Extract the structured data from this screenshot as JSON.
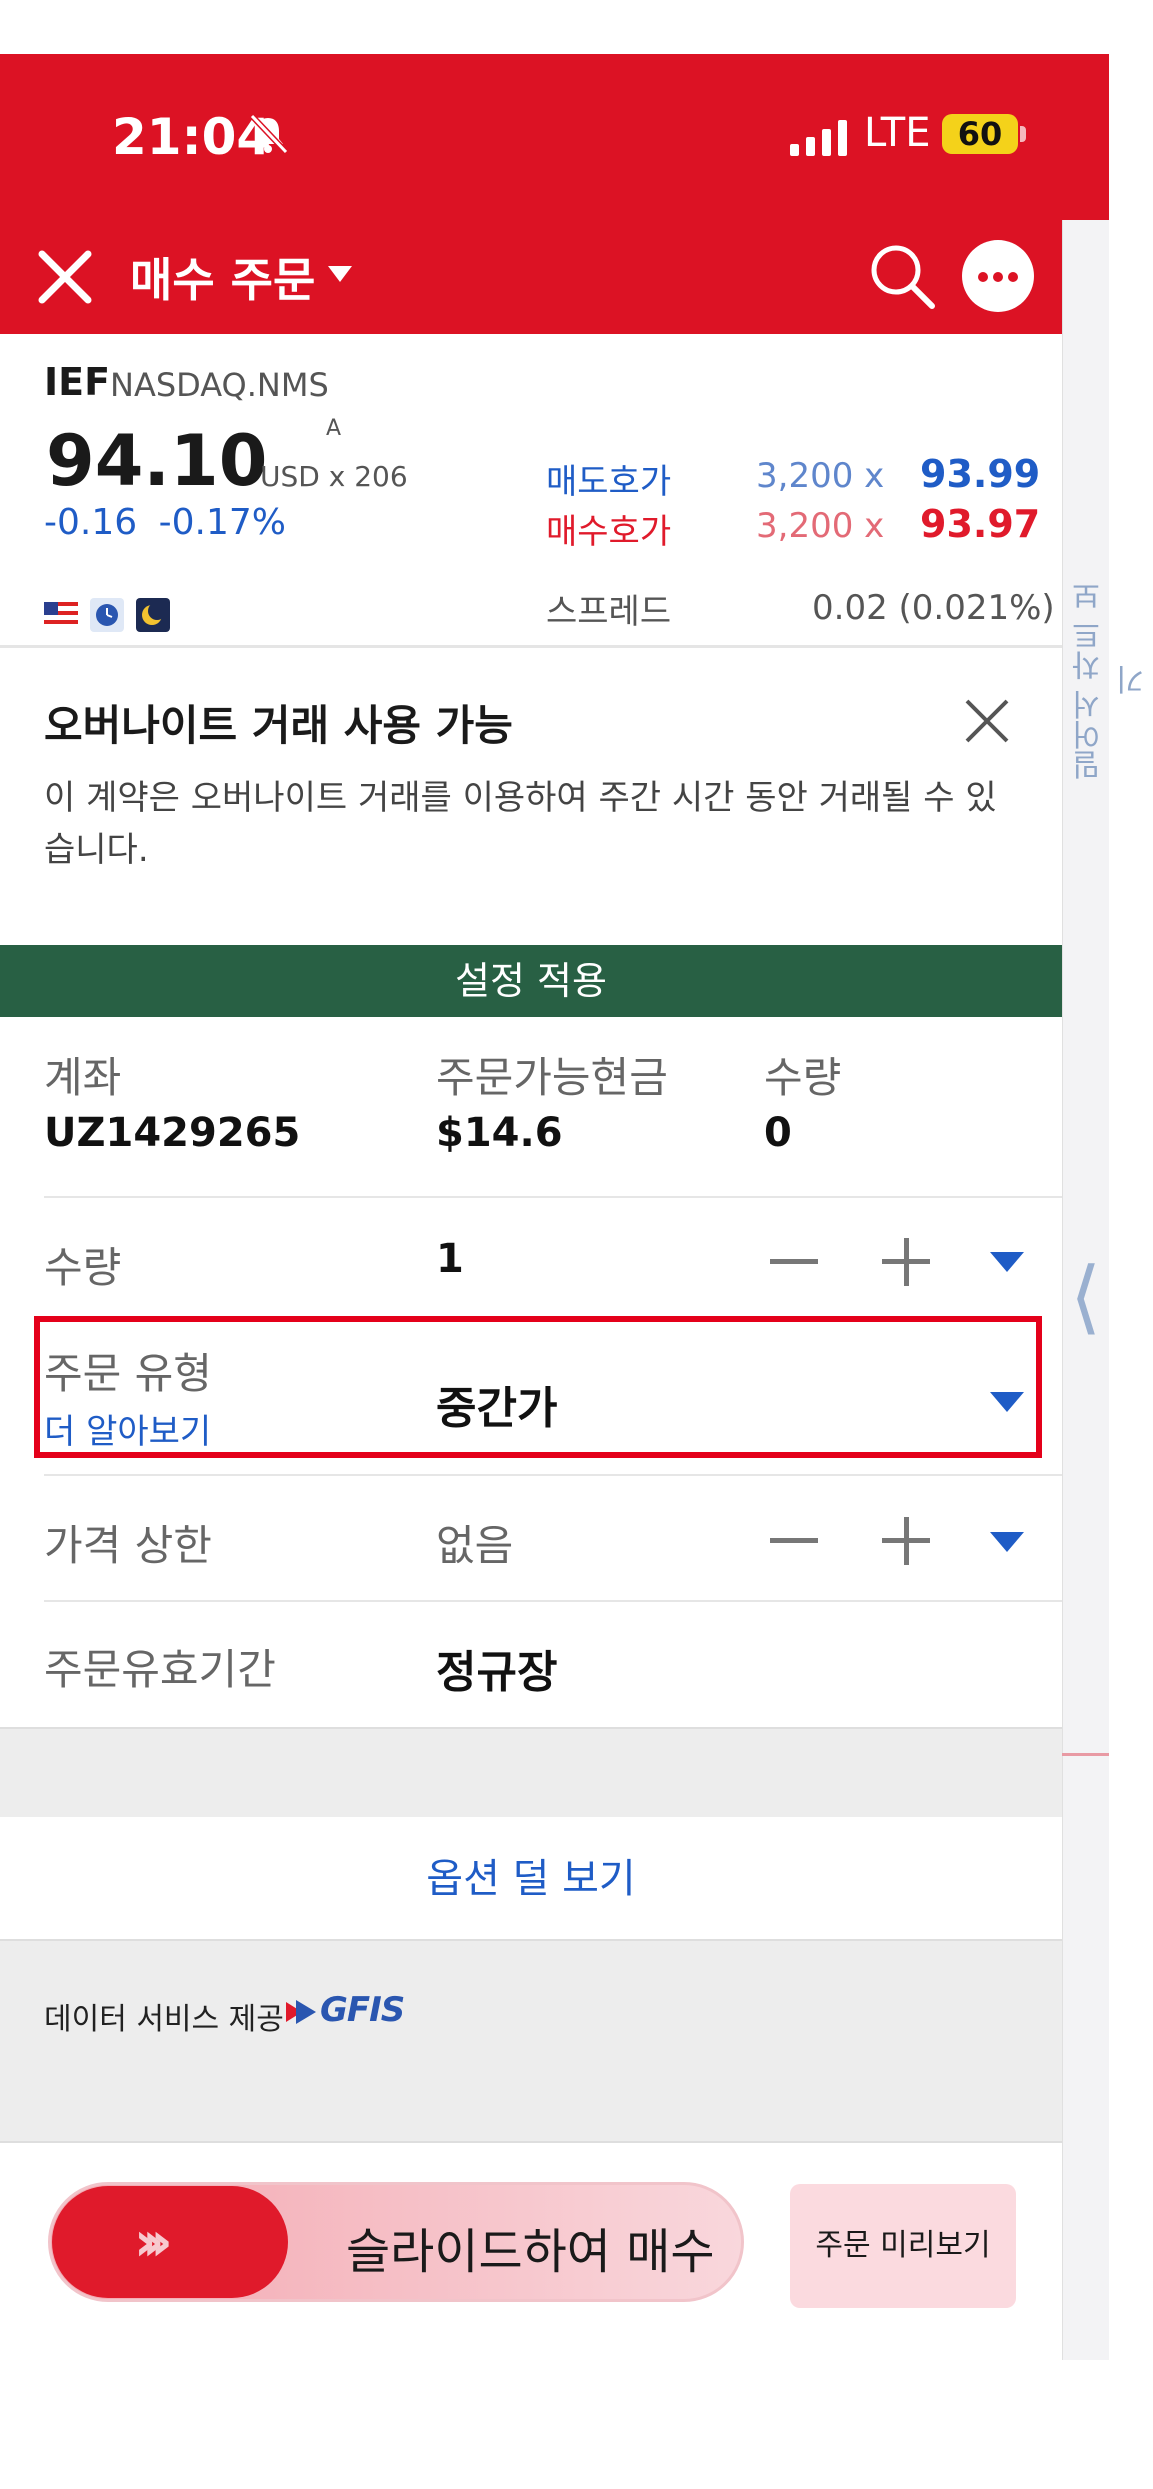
{
  "status_bar": {
    "time": "21:04",
    "network": "LTE",
    "battery": "60"
  },
  "nav": {
    "title": "매수 주문"
  },
  "quote": {
    "symbol": "IEF",
    "exchange": "NASDAQ.NMS",
    "last_price": "94.10",
    "currency": "USD",
    "size_prefix": "x",
    "size": "206",
    "size_marker": "A",
    "change": "-0.16",
    "change_pct": "-0.17%",
    "ask_label": "매도호가",
    "ask_size": "3,200",
    "ask_x": "x",
    "ask_price": "93.99",
    "bid_label": "매수호가",
    "bid_size": "3,200",
    "bid_x": "x",
    "bid_price": "93.97",
    "spread_label": "스프레드",
    "spread_value": "0.02 (0.021%)"
  },
  "banner": {
    "title": "오버나이트 거래 사용 가능",
    "description": "이 계약은 오버나이트 거래를 이용하여 주간 시간 동안 거래될 수 있습니다."
  },
  "apply_settings": "설정 적용",
  "account": {
    "account_label": "계좌",
    "account_value": "UZ1429265",
    "cash_label": "주문가능현금",
    "cash_value": "$14.6",
    "qty_label": "수량",
    "qty_value": "0"
  },
  "form": {
    "quantity_label": "수량",
    "quantity_value": "1",
    "order_type_label": "주문 유형",
    "learn_more": "더 알아보기",
    "order_type_value": "중간가",
    "price_cap_label": "가격 상한",
    "price_cap_value": "없음",
    "tif_label": "주문유효기간",
    "tif_value": "정규장"
  },
  "fewer_options": "옵션 덜 보기",
  "data_provider": {
    "label": "데이터 서비스 제공",
    "brand": "GFIS"
  },
  "footer": {
    "slide_label": "슬라이드하여 매수",
    "preview_label": "주문 미리보기"
  },
  "side_panel": {
    "label": "밀어서 차트 보기"
  },
  "colors": {
    "brand_red": "#dc1224",
    "apply_green": "#286044",
    "link_blue": "#1f5cc6",
    "bid_red": "#e01a2b"
  }
}
